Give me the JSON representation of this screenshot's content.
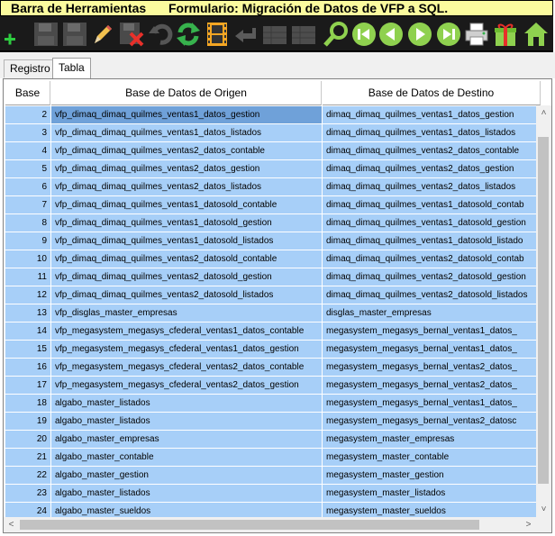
{
  "window": {
    "title_left": "Barra de Herramientas",
    "title_right": "Formulario: Migración de Datos de VFP a SQL."
  },
  "toolbar": {
    "buttons": [
      {
        "icon": "add-icon",
        "enabled": true
      },
      {
        "icon": "save-icon",
        "enabled": false
      },
      {
        "icon": "save-as-icon",
        "enabled": false
      },
      {
        "icon": "edit-pencil-icon",
        "enabled": true
      },
      {
        "icon": "delete-icon",
        "enabled": true
      },
      {
        "icon": "undo-icon",
        "enabled": false
      },
      {
        "icon": "refresh-icon",
        "enabled": true
      },
      {
        "icon": "film-icon",
        "enabled": true
      },
      {
        "icon": "back-arrow-icon",
        "enabled": false
      },
      {
        "icon": "grid-icon",
        "enabled": false
      },
      {
        "icon": "grid2-icon",
        "enabled": false
      },
      {
        "icon": "search-icon",
        "enabled": true
      },
      {
        "icon": "first-record-icon",
        "enabled": true
      },
      {
        "icon": "previous-record-icon",
        "enabled": true
      },
      {
        "icon": "next-record-icon",
        "enabled": true
      },
      {
        "icon": "last-record-icon",
        "enabled": true
      },
      {
        "icon": "printer-icon",
        "enabled": true
      },
      {
        "icon": "gift-icon",
        "enabled": true
      },
      {
        "icon": "home-icon",
        "enabled": true
      }
    ]
  },
  "tabs": [
    {
      "label": "Registro",
      "active": false
    },
    {
      "label": "Tabla",
      "active": true
    }
  ],
  "table": {
    "columns": [
      "Base",
      "Base de Datos de Origen",
      "Base de Datos de Destino"
    ],
    "rows": [
      {
        "base": "2",
        "origen": "vfp_dimaq_dimaq_quilmes_ventas1_datos_gestion",
        "destino": "dimaq_dimaq_quilmes_ventas1_datos_gestion",
        "selected": true
      },
      {
        "base": "3",
        "origen": "vfp_dimaq_dimaq_quilmes_ventas1_datos_listados",
        "destino": "dimaq_dimaq_quilmes_ventas1_datos_listados"
      },
      {
        "base": "4",
        "origen": "vfp_dimaq_dimaq_quilmes_ventas2_datos_contable",
        "destino": "dimaq_dimaq_quilmes_ventas2_datos_contable"
      },
      {
        "base": "5",
        "origen": "vfp_dimaq_dimaq_quilmes_ventas2_datos_gestion",
        "destino": "dimaq_dimaq_quilmes_ventas2_datos_gestion"
      },
      {
        "base": "6",
        "origen": "vfp_dimaq_dimaq_quilmes_ventas2_datos_listados",
        "destino": "dimaq_dimaq_quilmes_ventas2_datos_listados"
      },
      {
        "base": "7",
        "origen": "vfp_dimaq_dimaq_quilmes_ventas1_datosold_contable",
        "destino": "dimaq_dimaq_quilmes_ventas1_datosold_contab"
      },
      {
        "base": "8",
        "origen": "vfp_dimaq_dimaq_quilmes_ventas1_datosold_gestion",
        "destino": "dimaq_dimaq_quilmes_ventas1_datosold_gestion"
      },
      {
        "base": "9",
        "origen": "vfp_dimaq_dimaq_quilmes_ventas1_datosold_listados",
        "destino": "dimaq_dimaq_quilmes_ventas1_datosold_listado"
      },
      {
        "base": "10",
        "origen": "vfp_dimaq_dimaq_quilmes_ventas2_datosold_contable",
        "destino": "dimaq_dimaq_quilmes_ventas2_datosold_contab"
      },
      {
        "base": "11",
        "origen": "vfp_dimaq_dimaq_quilmes_ventas2_datosold_gestion",
        "destino": "dimaq_dimaq_quilmes_ventas2_datosold_gestion"
      },
      {
        "base": "12",
        "origen": "vfp_dimaq_dimaq_quilmes_ventas2_datosold_listados",
        "destino": "dimaq_dimaq_quilmes_ventas2_datosold_listados"
      },
      {
        "base": "13",
        "origen": "vfp_disglas_master_empresas",
        "destino": "disglas_master_empresas"
      },
      {
        "base": "14",
        "origen": "vfp_megasystem_megasys_cfederal_ventas1_datos_contable",
        "destino": "megasystem_megasys_bernal_ventas1_datos_"
      },
      {
        "base": "15",
        "origen": "vfp_megasystem_megasys_cfederal_ventas1_datos_gestion",
        "destino": "megasystem_megasys_bernal_ventas1_datos_"
      },
      {
        "base": "16",
        "origen": "vfp_megasystem_megasys_cfederal_ventas2_datos_contable",
        "destino": "megasystem_megasys_bernal_ventas2_datos_"
      },
      {
        "base": "17",
        "origen": "vfp_megasystem_megasys_cfederal_ventas2_datos_gestion",
        "destino": "megasystem_megasys_bernal_ventas2_datos_"
      },
      {
        "base": "18",
        "origen": "algabo_master_listados",
        "destino": "megasystem_megasys_bernal_ventas1_datos_"
      },
      {
        "base": "19",
        "origen": "algabo_master_listados",
        "destino": "megasystem_megasys_bernal_ventas2_datosc"
      },
      {
        "base": "20",
        "origen": "algabo_master_empresas",
        "destino": "megasystem_master_empresas"
      },
      {
        "base": "21",
        "origen": "algabo_master_contable",
        "destino": "megasystem_master_contable"
      },
      {
        "base": "22",
        "origen": "algabo_master_gestion",
        "destino": "megasystem_master_gestion"
      },
      {
        "base": "23",
        "origen": "algabo_master_listados",
        "destino": "megasystem_master_listados"
      },
      {
        "base": "24",
        "origen": "algabo_master_sueldos",
        "destino": "megasystem_master_sueldos"
      }
    ]
  },
  "scrollbars": {
    "up_arrow": "˄",
    "down_arrow": "˅",
    "left_arrow": "<",
    "right_arrow": ">"
  },
  "colors": {
    "title_bg": "#fbfb9e",
    "toolbar_bg": "#1a1a1a",
    "row_bg": "#a7cff8",
    "selected_cell_bg": "#6fa1d9"
  }
}
